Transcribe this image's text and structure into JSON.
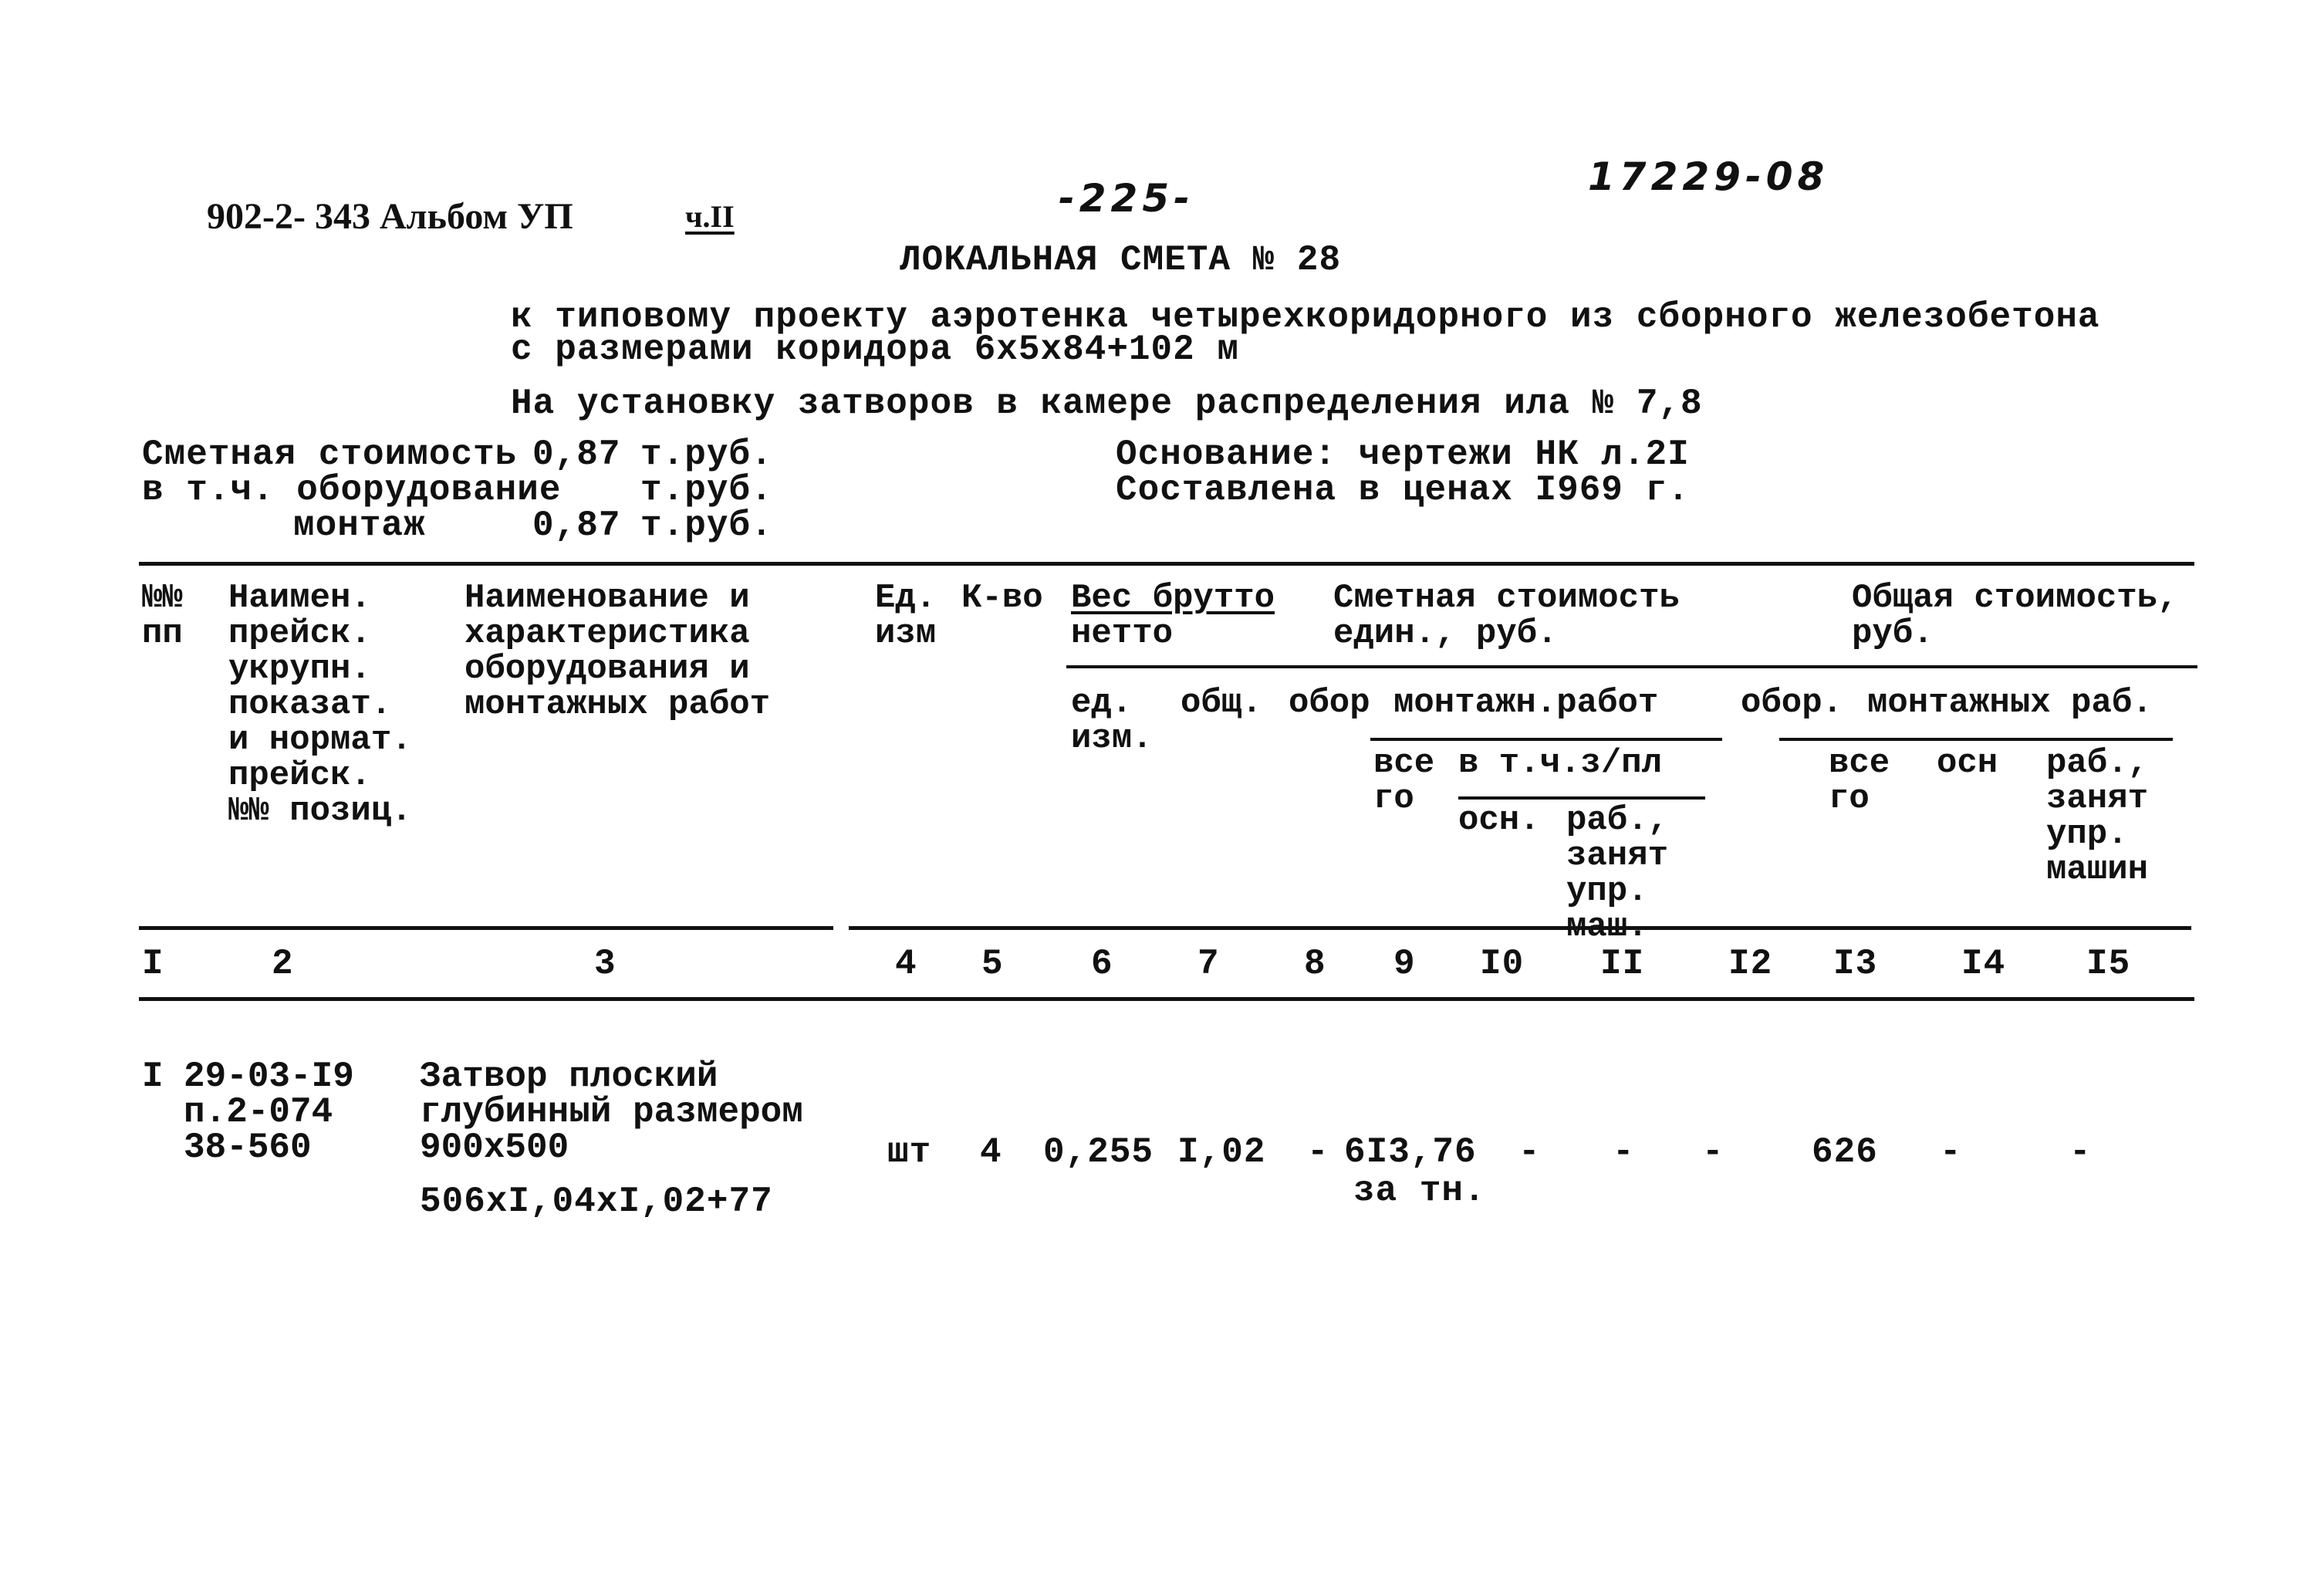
{
  "header": {
    "album_code": "902-2- 343 Альбом УП",
    "part": "ч.II",
    "page_number": "-225-",
    "doc_number": "17229-08",
    "title": "ЛОКАЛЬНАЯ СМЕТА № 28",
    "subtitle_line1": "к типовому проекту аэротенка четырехкоридорного из сборного железобетона",
    "subtitle_line2": "с размерами коридора 6х5х84+102 м",
    "purpose": "На установку затворов в камере распределения ила № 7,8"
  },
  "summary": {
    "cost_label": "Сметная стоимость",
    "cost_value": "0,87",
    "cost_unit": "т.руб.",
    "incl_label": "в т.ч. оборудование",
    "equipment_value": "",
    "equipment_unit": "т.руб.",
    "install_label": "монтаж",
    "install_value": "0,87",
    "install_unit": "т.руб.",
    "basis": "Основание: чертежи НК л.2I",
    "prices": "Составлена в ценах I969 г."
  },
  "table": {
    "headers": {
      "col1": "№№\nпп",
      "col2": "Наимен.\nпрейск.\nукрупн.\nпоказат.\nи нормат.\nпрейск.\n№№ позиц.",
      "col3": "Наименование и\nхарактеристика\nоборудования и\nмонтажных работ",
      "col4": "Ед.\nизм",
      "col5": "К-во",
      "weight_brutto": "Вес брутто",
      "weight_netto": "нетто",
      "unit_cost": "Сметная стоимость\nедин., руб.",
      "total_cost": "Общая стоимость,\nруб.",
      "col6": "ед.\nизм.",
      "col7": "общ.",
      "col8": "обор",
      "install_works": "монтажн.работ",
      "col9": "все\nго",
      "incl_wages": "в т.ч.з/пл",
      "col10": "осн.",
      "col11": "раб.,\nзанят\nупр.\nмаш.",
      "total_equipment": "обор.",
      "total_install": "монтажных раб.",
      "col13": "все\nго",
      "col14": "осн",
      "col15": "раб.,\nзанят\nупр.\nмашин"
    },
    "column_numbers": [
      "I",
      "2",
      "3",
      "4",
      "5",
      "6",
      "7",
      "8",
      "9",
      "I0",
      "II",
      "I2",
      "I3",
      "I4",
      "I5"
    ],
    "rows": [
      {
        "num": "I",
        "price_ref": "29-03-I9\nп.2-074\n38-560",
        "name": "Затвор плоский\nглубинный размером\n900х500",
        "formula": "506хI,04хI,02+77",
        "unit": "шт",
        "qty": "4",
        "weight_unit": "0,255",
        "weight_total": "I,02",
        "equip_unit": "-",
        "install_unit_total": "6I3,76",
        "install_unit_note": "за тн.",
        "wage_base": "-",
        "wage_machines": "-",
        "equip_total": "-",
        "install_total": "626",
        "install_base_total": "-",
        "install_machines_total": "-"
      }
    ]
  }
}
